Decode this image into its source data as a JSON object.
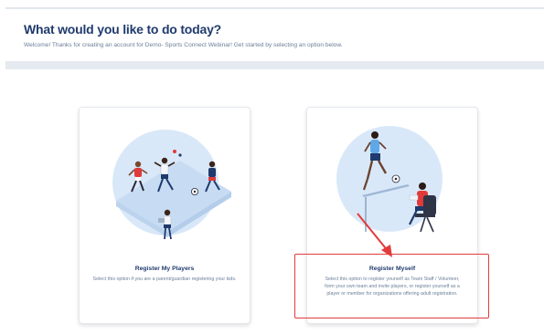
{
  "header": {
    "title": "What would you like to do today?",
    "subtitle": "Welcome! Thanks for creating an account for Demo- Sports Connect Webinar! Get started by selecting an option below."
  },
  "options": [
    {
      "title": "Register My Players",
      "description": "Select this option if you are a parent/guardian registering your kids.",
      "illustration": "youth-soccer-players-illustration"
    },
    {
      "title": "Register Myself",
      "description": "Select this option to register yourself as Team Staff / Volunteer, form your own team and invite players, or register yourself as a player or member for organizations offering adult registration.",
      "illustration": "adult-player-and-registrar-illustration"
    }
  ],
  "annotation": {
    "highlight_color": "#e23b3b",
    "arrow_icon": "red-arrow-icon"
  },
  "colors": {
    "title": "#1f3a6d",
    "text": "#6a7f99",
    "illustration_bg": "#d7e6f7"
  }
}
